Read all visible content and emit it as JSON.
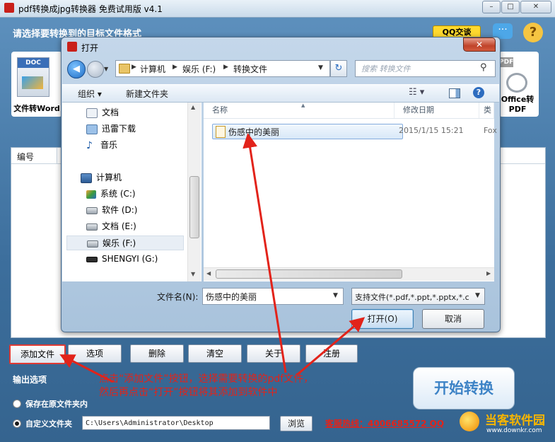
{
  "app": {
    "title": "pdf转换成jpg转换器 免费试用版 v4.1",
    "header": "请选择要转换到的目标文件格式",
    "qq_badge": "QQ交谈",
    "window_buttons": [
      "–",
      "□",
      "✕"
    ],
    "tiles": [
      {
        "badge": "DOC",
        "label": "文件转Word"
      },
      {
        "badge": "PDF",
        "label": "Office转PDF"
      }
    ],
    "list_columns": [
      "编号"
    ],
    "buttons": {
      "add": "添加文件",
      "options": "选项",
      "delete": "删除",
      "clear": "清空",
      "about": "关于",
      "register": "注册"
    },
    "output": {
      "title": "输出选项",
      "option_original": "保存在原文件夹内",
      "option_custom": "自定义文件夹",
      "selected": "custom",
      "path": "C:\\Users\\Administrator\\Desktop",
      "browse": "浏览"
    },
    "hotline": "客服热线：4006685572 QQ",
    "start": "开始转换",
    "watermark": "当客软件园",
    "watermark_url": "www.downkr.com"
  },
  "dialog": {
    "title": "打开",
    "close": "✕",
    "breadcrumb": [
      "计算机",
      "娱乐 (F:)",
      "转换文件"
    ],
    "search_placeholder": "搜索 转换文件",
    "toolbar": {
      "organize": "组织 ▾",
      "new_folder": "新建文件夹"
    },
    "nav_items": [
      {
        "icon": "document-library-icon",
        "label": "文档",
        "indent": true
      },
      {
        "icon": "download-folder-icon",
        "label": "迅雷下载",
        "indent": true
      },
      {
        "icon": "music-icon",
        "label": "音乐",
        "indent": true
      },
      {
        "icon": "computer-icon",
        "label": "计算机",
        "indent": false
      },
      {
        "icon": "system-drive-icon",
        "label": "系统 (C:)",
        "indent": true
      },
      {
        "icon": "drive-icon",
        "label": "软件 (D:)",
        "indent": true
      },
      {
        "icon": "drive-icon",
        "label": "文档 (E:)",
        "indent": true
      },
      {
        "icon": "drive-icon",
        "label": "娱乐 (F:)",
        "indent": true,
        "selected": true
      },
      {
        "icon": "usb-drive-icon",
        "label": "SHENGYI (G:)",
        "indent": true
      }
    ],
    "columns": [
      "名称",
      "修改日期",
      "类型"
    ],
    "files": [
      {
        "name": "伤感中的美丽",
        "date": "2015/1/15 15:21",
        "type": "Fox"
      }
    ],
    "filename_label": "文件名(N):",
    "filename_value": "伤感中的美丽",
    "filetype_value": "支持文件(*.pdf,*.ppt,*.pptx,*.c",
    "open": "打开(O)",
    "cancel": "取消"
  },
  "annotation": {
    "line1": "点击“添加文件”按钮，选择需要转换的pdf文件，",
    "line2": "然后再点击“打开”按钮将其添加到软件中"
  },
  "colors": {
    "annotation": "#e2231a",
    "accent": "#3d83c6"
  }
}
